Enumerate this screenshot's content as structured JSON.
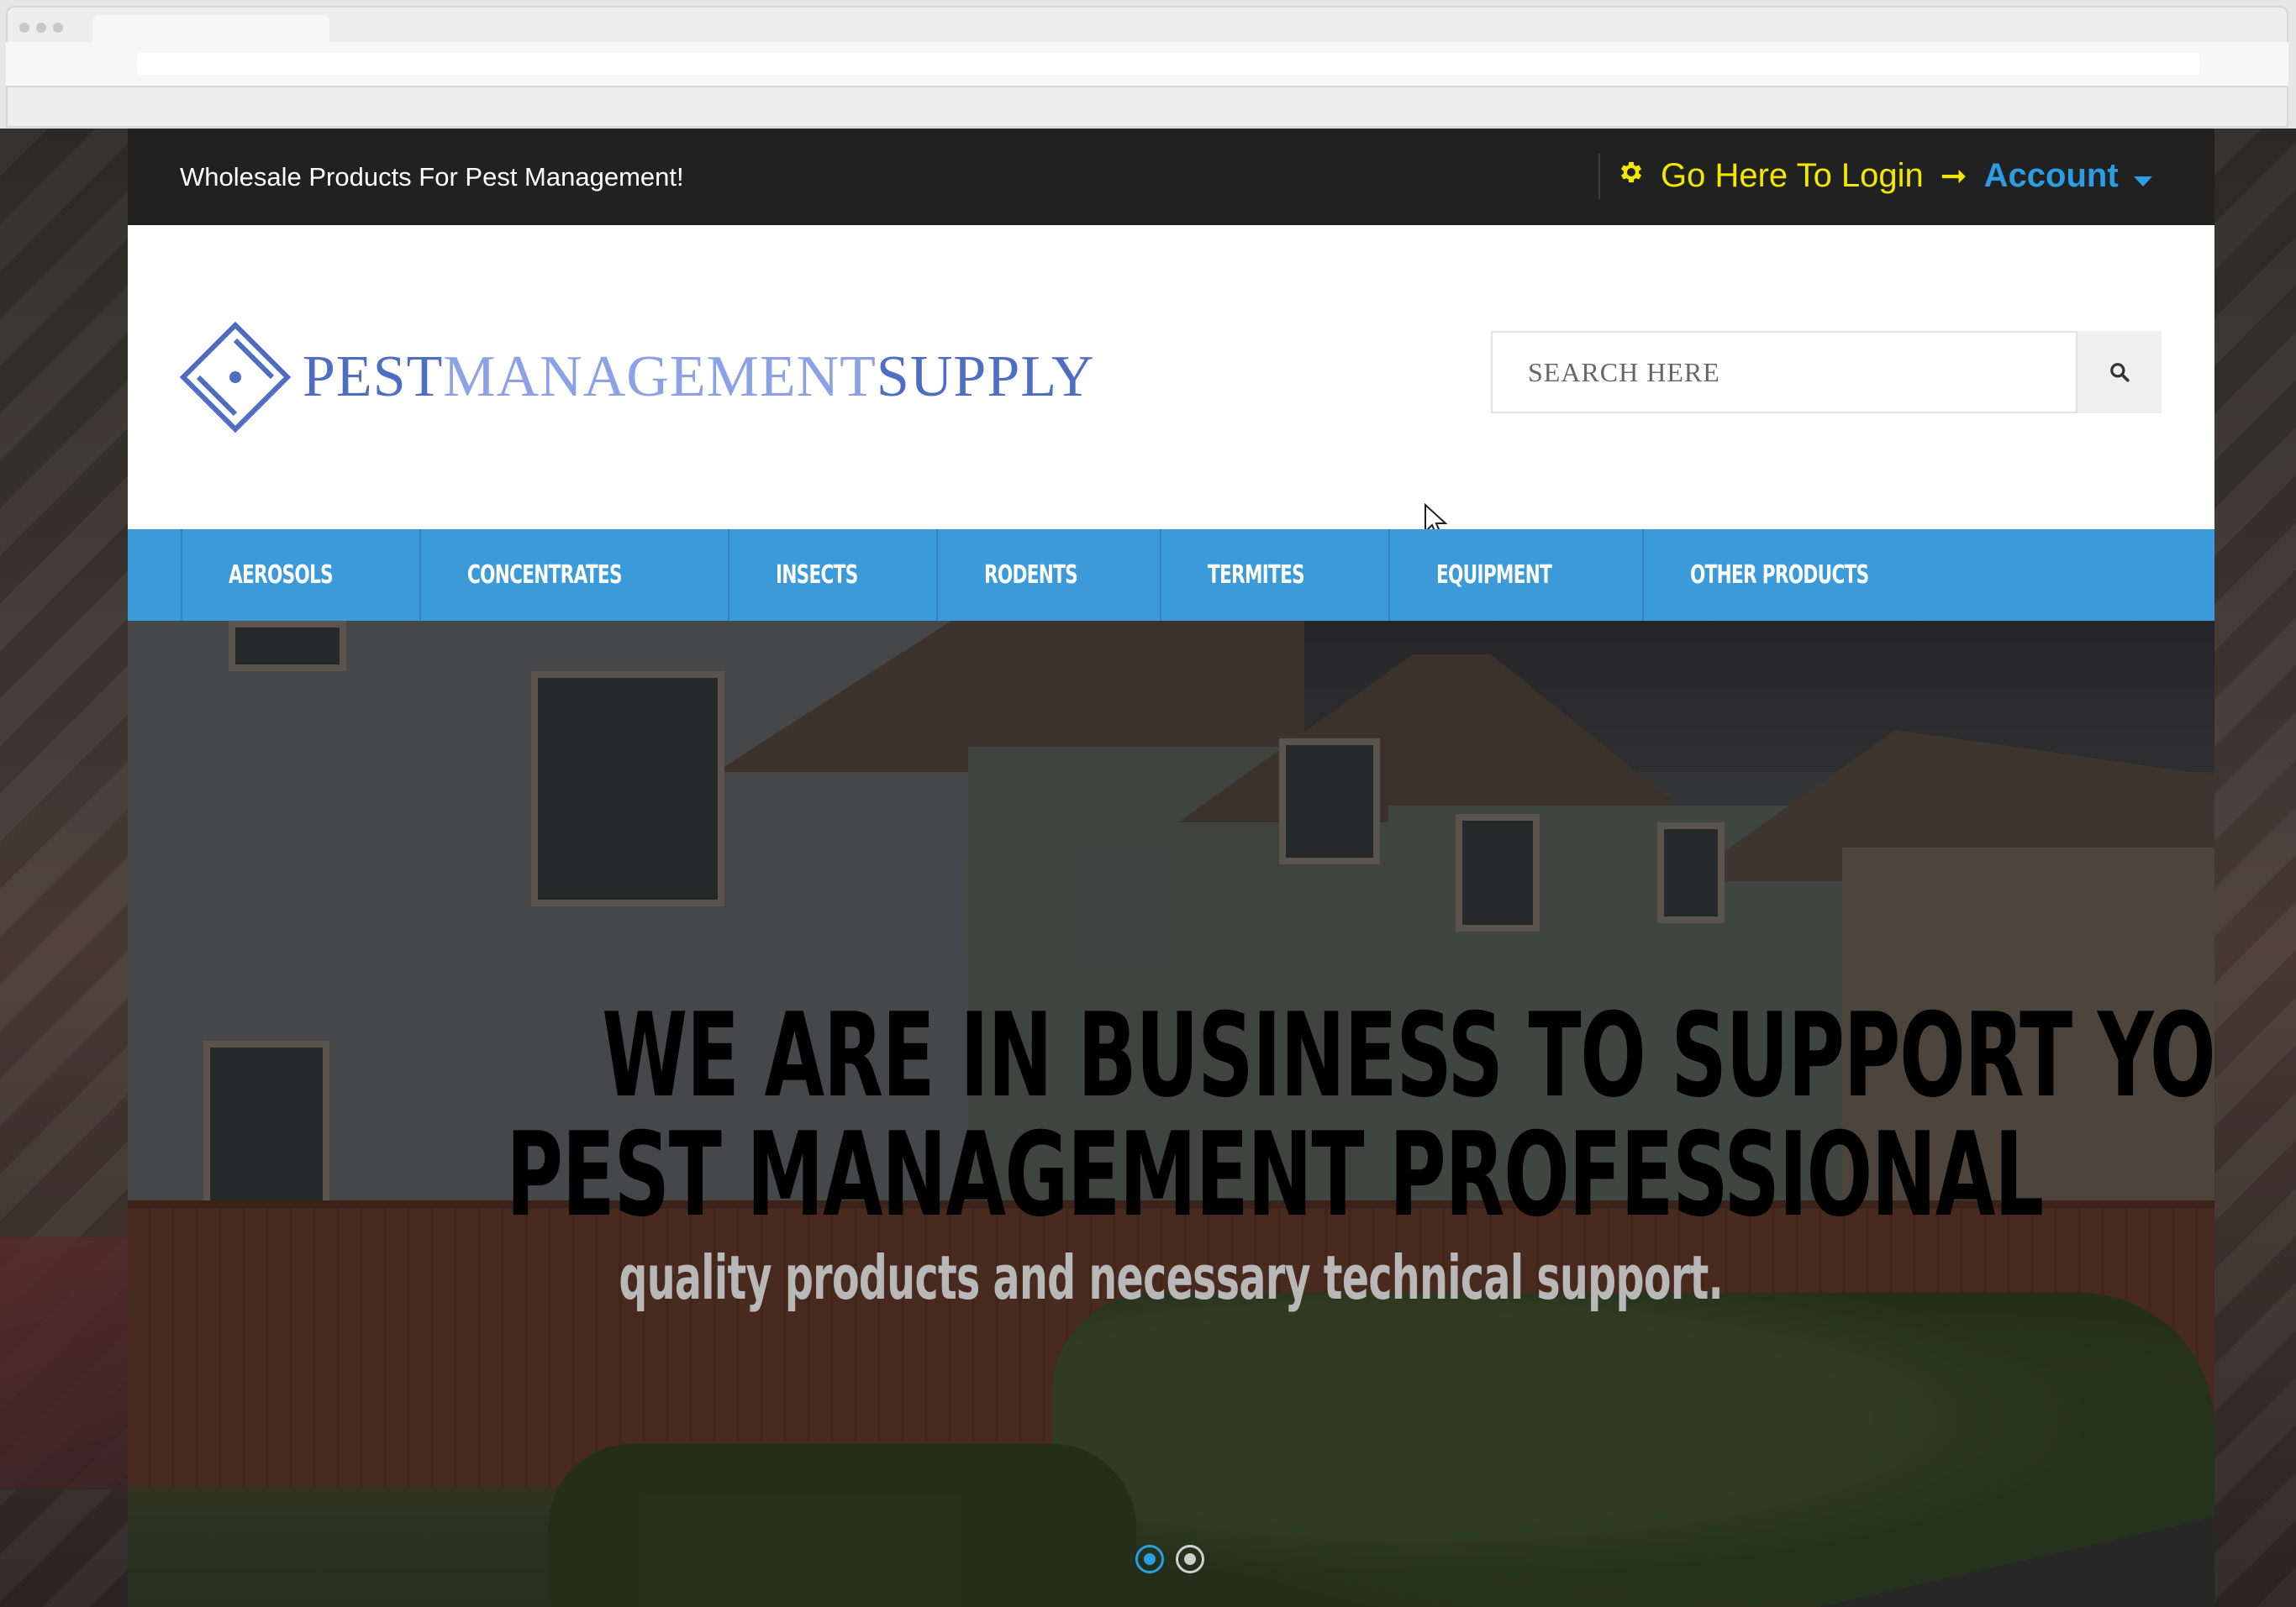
{
  "topbar": {
    "tagline": "Wholesale Products For Pest Management!",
    "login_icon": "gear-icon",
    "login_label": "Go Here To Login",
    "login_arrow": "➞",
    "account_label": "Account",
    "login_color": "#f3e600",
    "account_color": "#2b9de3"
  },
  "header": {
    "logo": {
      "part1": "PEST",
      "part2": "MANAGEMENT",
      "part3": "SUPPLY"
    },
    "search": {
      "placeholder": "SEARCH HERE",
      "icon": "search-icon"
    }
  },
  "nav": {
    "items": [
      {
        "label": "AEROSOLS"
      },
      {
        "label": "CONCENTRATES"
      },
      {
        "label": "INSECTS"
      },
      {
        "label": "RODENTS"
      },
      {
        "label": "TERMITES"
      },
      {
        "label": "EQUIPMENT"
      },
      {
        "label": "OTHER PRODUCTS"
      }
    ],
    "color": "#3b9ad9"
  },
  "hero": {
    "headline_line1": "WE ARE IN BUSINESS TO SUPPORT YOU - THE",
    "headline_line2": "PEST MANAGEMENT PROFESSIONAL",
    "subheadline": "quality products and necessary technical support.",
    "slides": {
      "count": 2,
      "active": 1
    }
  }
}
